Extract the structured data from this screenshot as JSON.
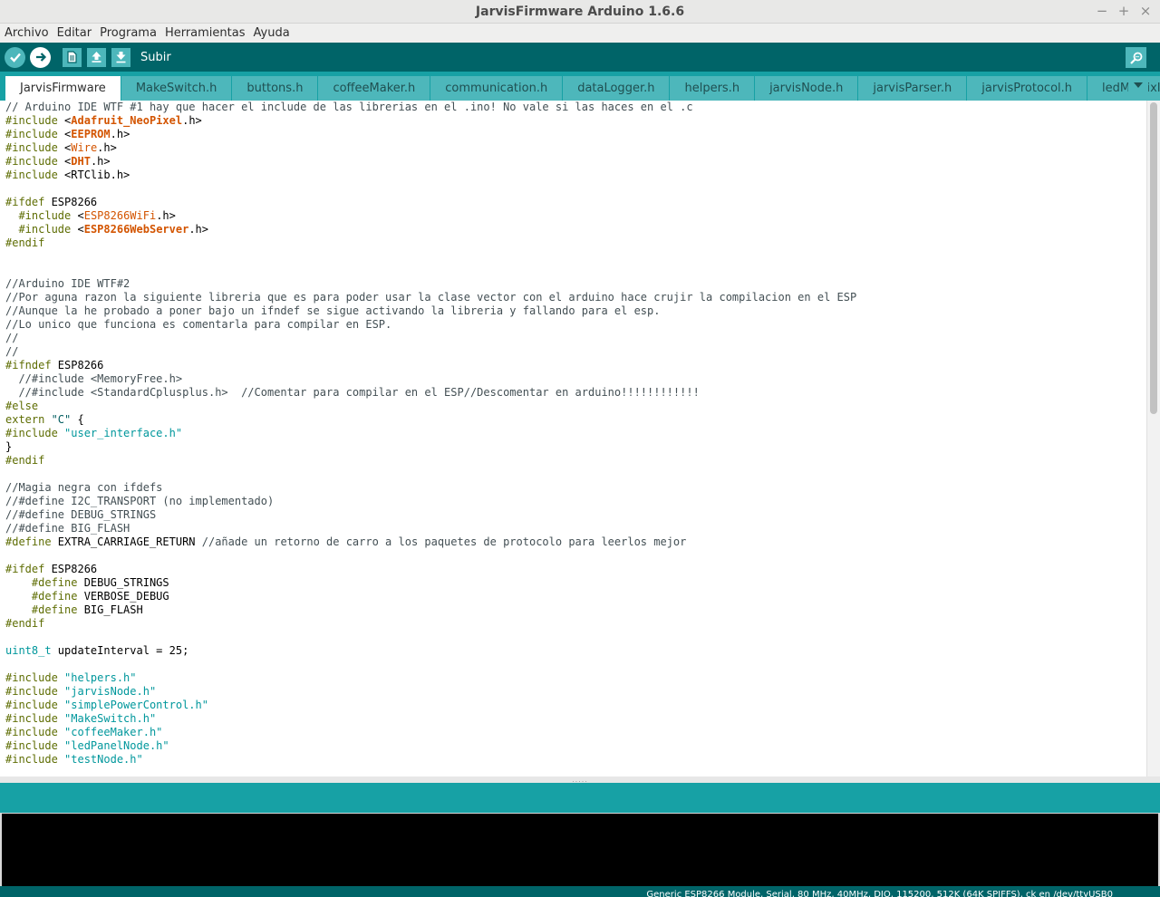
{
  "window": {
    "title": "JarvisFirmware Arduino 1.6.6",
    "controls": [
      "−",
      "+",
      "×"
    ]
  },
  "menu": [
    "Archivo",
    "Editar",
    "Programa",
    "Herramientas",
    "Ayuda"
  ],
  "toolbar": {
    "upload_label": "Subir",
    "icons": [
      "verify-icon",
      "upload-icon",
      "new-icon",
      "open-icon",
      "save-icon",
      "serial-monitor-icon"
    ]
  },
  "tabs": [
    {
      "label": "JarvisFirmware",
      "active": true
    },
    {
      "label": "MakeSwitch.h"
    },
    {
      "label": "buttons.h"
    },
    {
      "label": "coffeeMaker.h"
    },
    {
      "label": "communication.h"
    },
    {
      "label": "dataLogger.h"
    },
    {
      "label": "helpers.h"
    },
    {
      "label": "jarvisNode.h"
    },
    {
      "label": "jarvisParser.h"
    },
    {
      "label": "jarvisProtocol.h"
    },
    {
      "label": "ledMatrixIcons.h"
    }
  ],
  "code": [
    [
      [
        "comment",
        "// Arduino IDE WTF #1 hay que hacer el include de las librerias en el .ino! No vale si las haces en el .c"
      ]
    ],
    [
      [
        "pre",
        "#include "
      ],
      [
        "text",
        "<"
      ],
      [
        "libbold",
        "Adafruit_NeoPixel"
      ],
      [
        "text",
        ".h>"
      ]
    ],
    [
      [
        "pre",
        "#include "
      ],
      [
        "text",
        "<"
      ],
      [
        "libbold",
        "EEPROM"
      ],
      [
        "text",
        ".h>"
      ]
    ],
    [
      [
        "pre",
        "#include "
      ],
      [
        "text",
        "<"
      ],
      [
        "lib",
        "Wire"
      ],
      [
        "text",
        ".h>"
      ]
    ],
    [
      [
        "pre",
        "#include "
      ],
      [
        "text",
        "<"
      ],
      [
        "libbold",
        "DHT"
      ],
      [
        "text",
        ".h>"
      ]
    ],
    [
      [
        "pre",
        "#include "
      ],
      [
        "text",
        "<RTClib.h>"
      ]
    ],
    [],
    [
      [
        "pre",
        "#ifdef "
      ],
      [
        "text",
        "ESP8266"
      ]
    ],
    [
      [
        "pre",
        "  #include "
      ],
      [
        "text",
        "<"
      ],
      [
        "lib",
        "ESP8266WiFi"
      ],
      [
        "text",
        ".h>"
      ]
    ],
    [
      [
        "pre",
        "  #include "
      ],
      [
        "text",
        "<"
      ],
      [
        "libbold",
        "ESP8266WebServer"
      ],
      [
        "text",
        ".h>"
      ]
    ],
    [
      [
        "pre",
        "#endif"
      ]
    ],
    [],
    [],
    [
      [
        "comment",
        "//Arduino IDE WTF#2"
      ]
    ],
    [
      [
        "comment",
        "//Por aguna razon la siguiente libreria que es para poder usar la clase vector con el arduino hace crujir la compilacion en el ESP"
      ]
    ],
    [
      [
        "comment",
        "//Aunque la he probado a poner bajo un ifndef se sigue activando la libreria y fallando para el esp."
      ]
    ],
    [
      [
        "comment",
        "//Lo unico que funciona es comentarla para compilar en ESP."
      ]
    ],
    [
      [
        "comment",
        "//"
      ]
    ],
    [
      [
        "comment",
        "//"
      ]
    ],
    [
      [
        "pre",
        "#ifndef "
      ],
      [
        "text",
        "ESP8266"
      ]
    ],
    [
      [
        "comment",
        "  //#include <MemoryFree.h>"
      ]
    ],
    [
      [
        "comment",
        "  //#include <StandardCplusplus.h>  //Comentar para compilar en el ESP//Descomentar en arduino!!!!!!!!!!!!"
      ]
    ],
    [
      [
        "pre",
        "#else"
      ]
    ],
    [
      [
        "pre",
        "extern "
      ],
      [
        "str",
        "\"C\""
      ],
      [
        "text",
        " {"
      ]
    ],
    [
      [
        "pre",
        "#include "
      ],
      [
        "str2",
        "\"user_interface.h\""
      ]
    ],
    [
      [
        "text",
        "}"
      ]
    ],
    [
      [
        "pre",
        "#endif"
      ]
    ],
    [],
    [
      [
        "comment",
        "//Magia negra con ifdefs"
      ]
    ],
    [
      [
        "comment",
        "//#define I2C_TRANSPORT (no implementado)"
      ]
    ],
    [
      [
        "comment",
        "//#define DEBUG_STRINGS"
      ]
    ],
    [
      [
        "comment",
        "//#define BIG_FLASH"
      ]
    ],
    [
      [
        "pre",
        "#define "
      ],
      [
        "text",
        "EXTRA_CARRIAGE_RETURN "
      ],
      [
        "comment",
        "//añade un retorno de carro a los paquetes de protocolo para leerlos mejor"
      ]
    ],
    [],
    [
      [
        "pre",
        "#ifdef "
      ],
      [
        "text",
        "ESP8266"
      ]
    ],
    [
      [
        "pre",
        "    #define "
      ],
      [
        "text",
        "DEBUG_STRINGS"
      ]
    ],
    [
      [
        "pre",
        "    #define "
      ],
      [
        "text",
        "VERBOSE_DEBUG"
      ]
    ],
    [
      [
        "pre",
        "    #define "
      ],
      [
        "text",
        "BIG_FLASH"
      ]
    ],
    [
      [
        "pre",
        "#endif"
      ]
    ],
    [],
    [
      [
        "type",
        "uint8_t"
      ],
      [
        "text",
        " updateInterval = 25;"
      ]
    ],
    [],
    [
      [
        "pre",
        "#include "
      ],
      [
        "str2",
        "\"helpers.h\""
      ]
    ],
    [
      [
        "pre",
        "#include "
      ],
      [
        "str2",
        "\"jarvisNode.h\""
      ]
    ],
    [
      [
        "pre",
        "#include "
      ],
      [
        "str2",
        "\"simplePowerControl.h\""
      ]
    ],
    [
      [
        "pre",
        "#include "
      ],
      [
        "str2",
        "\"MakeSwitch.h\""
      ]
    ],
    [
      [
        "pre",
        "#include "
      ],
      [
        "str2",
        "\"coffeeMaker.h\""
      ]
    ],
    [
      [
        "pre",
        "#include "
      ],
      [
        "str2",
        "\"ledPanelNode.h\""
      ]
    ],
    [
      [
        "pre",
        "#include "
      ],
      [
        "str2",
        "\"testNode.h\""
      ]
    ]
  ],
  "splitter_grip": ".....",
  "footer": {
    "board_info": "Generic ESP8266 Module, Serial, 80 MHz, 40MHz, DIO, 115200, 512K (64K SPIFFS), ck en /dev/ttyUSB0"
  }
}
